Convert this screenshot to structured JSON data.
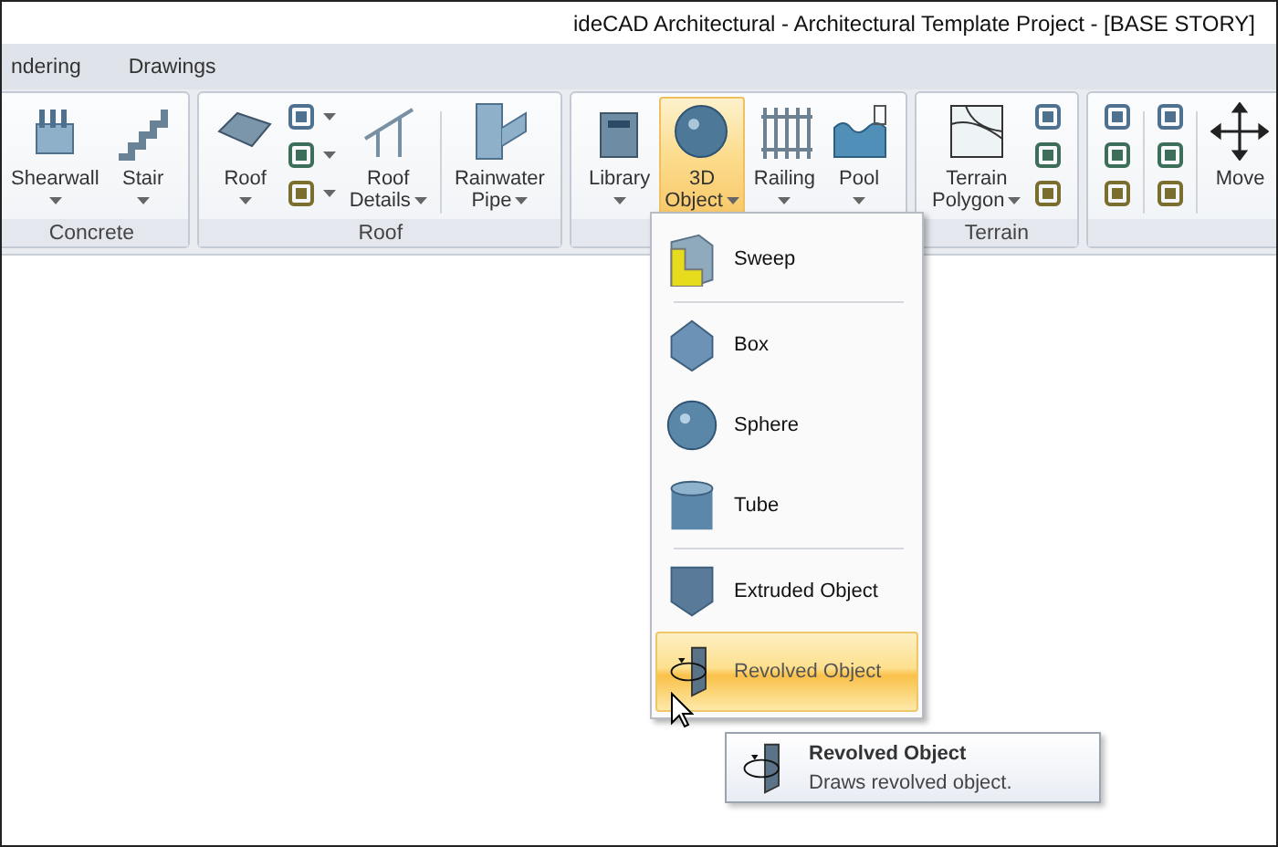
{
  "window": {
    "title": "ideCAD Architectural - Architectural Template Project - [BASE STORY]"
  },
  "tabs": [
    {
      "label": "ndering",
      "selected": false
    },
    {
      "label": "Drawings",
      "selected": false
    }
  ],
  "ribbon": [
    {
      "label": "Concrete",
      "items": [
        {
          "kind": "large",
          "lines": [
            "Shearwall"
          ],
          "dropdown": true,
          "selected": false
        },
        {
          "kind": "large",
          "lines": [
            "Stair"
          ],
          "dropdown": true,
          "selected": false
        }
      ]
    },
    {
      "label": "Roof",
      "items": [
        {
          "kind": "large",
          "lines": [
            "Roof"
          ],
          "dropdown": true,
          "selected": false
        },
        {
          "kind": "stack",
          "dropdowns": [
            true,
            true,
            true
          ]
        },
        {
          "kind": "large",
          "lines": [
            "Roof",
            "Details"
          ],
          "dropdown": true,
          "selected": false
        },
        {
          "kind": "divider"
        },
        {
          "kind": "large",
          "lines": [
            "Rainwater",
            "Pipe"
          ],
          "dropdown": true,
          "selected": false
        }
      ]
    },
    {
      "items": [
        {
          "kind": "large",
          "lines": [
            "Library"
          ],
          "dropdown": true,
          "selected": false
        },
        {
          "kind": "large",
          "lines": [
            "3D",
            "Object"
          ],
          "dropdown": true,
          "selected": true
        },
        {
          "kind": "large",
          "lines": [
            "Railing"
          ],
          "dropdown": true,
          "selected": false
        },
        {
          "kind": "large",
          "lines": [
            "Pool"
          ],
          "dropdown": true,
          "selected": false
        }
      ]
    },
    {
      "label": "Terrain",
      "items": [
        {
          "kind": "large",
          "lines": [
            "Terrain",
            "Polygon"
          ],
          "dropdown": true,
          "selected": false
        },
        {
          "kind": "stack",
          "dropdowns": [
            false,
            false,
            false
          ]
        }
      ]
    },
    {
      "items": [
        {
          "kind": "stack",
          "dropdowns": [
            false,
            false,
            false
          ]
        },
        {
          "kind": "divider"
        },
        {
          "kind": "stack",
          "dropdowns": [
            false,
            false,
            false
          ]
        },
        {
          "kind": "divider"
        },
        {
          "kind": "large",
          "lines": [
            "Move"
          ],
          "dropdown": false,
          "selected": false
        }
      ]
    }
  ],
  "menu": [
    {
      "kind": "item",
      "label": "Sweep",
      "selected": false
    },
    {
      "kind": "separator"
    },
    {
      "kind": "item",
      "label": "Box",
      "selected": false
    },
    {
      "kind": "item",
      "label": "Sphere",
      "selected": false
    },
    {
      "kind": "item",
      "label": "Tube",
      "selected": false
    },
    {
      "kind": "separator"
    },
    {
      "kind": "item",
      "label": "Extruded Object",
      "selected": false
    },
    {
      "kind": "item",
      "label": "Revolved Object",
      "selected": true
    }
  ],
  "tooltip": {
    "title": "Revolved Object",
    "text": "Draws revolved object."
  }
}
